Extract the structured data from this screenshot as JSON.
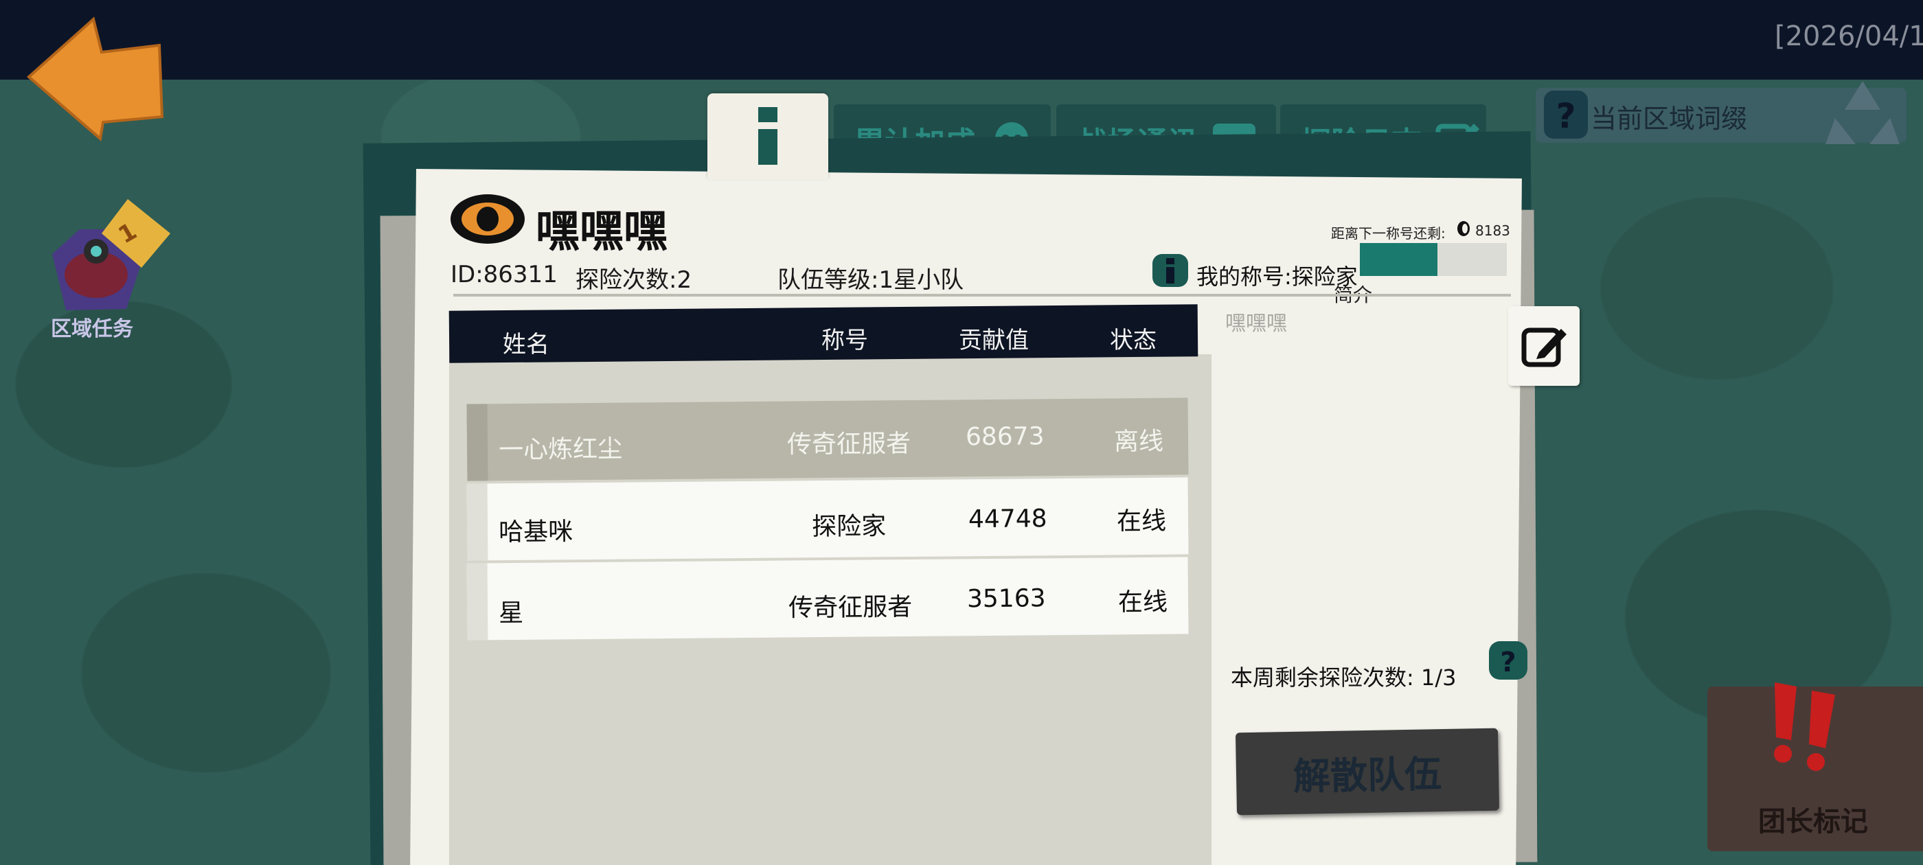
{
  "timestamp": "[2026/04/1",
  "region_task": {
    "label": "区域任务",
    "badge": "1"
  },
  "tabs": {
    "info_icon": "info-icon",
    "bonus": "累计加成",
    "comms": "战场通讯",
    "log": "探险日志"
  },
  "region_affix": {
    "label": "当前区域词缀"
  },
  "team": {
    "name": "嘿嘿嘿",
    "id": "ID:86311",
    "expeditions": "探险次数:2",
    "level": "队伍等级:1星小队",
    "next_title_label": "距离下一称号还剩:",
    "next_title_value": "8183",
    "my_title": "我的称号:探险家",
    "title_progress": 0.53,
    "intro_label": "简介",
    "intro_text": "嘿嘿嘿"
  },
  "table": {
    "headers": [
      "姓名",
      "称号",
      "贡献值",
      "状态"
    ],
    "rows": [
      {
        "name": "一心炼红尘",
        "title": "传奇征服者",
        "contribution": "68673",
        "status": "离线"
      },
      {
        "name": "哈基咪",
        "title": "探险家",
        "contribution": "44748",
        "status": "在线"
      },
      {
        "name": "星",
        "title": "传奇征服者",
        "contribution": "35163",
        "status": "在线"
      }
    ]
  },
  "weekly_remaining": "本周剩余探险次数:  1/3",
  "disband_label": "解散队伍",
  "leader_mark_label": "团长标记",
  "colors": {
    "accent_teal": "#1a7a6e",
    "topbar": "#0c1528",
    "paper": "#f2f1ea",
    "offline_row": "#b7b6a8"
  }
}
